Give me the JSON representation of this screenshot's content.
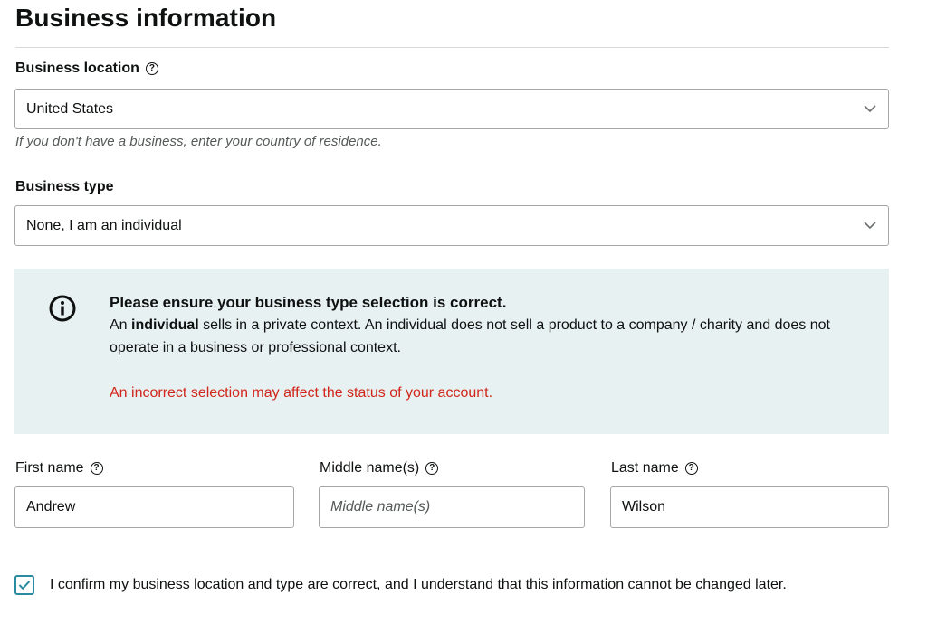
{
  "page": {
    "title": "Business information"
  },
  "business_location": {
    "label": "Business location",
    "value": "United States",
    "hint": "If you don't have a business, enter your country of residence."
  },
  "business_type": {
    "label": "Business type",
    "value": "None, I am an individual"
  },
  "alert": {
    "heading": "Please ensure your business type selection is correct.",
    "body_pre": "An ",
    "body_bold": "individual",
    "body_post": " sells in a private context. An individual does not sell a product to a company / charity and does not operate in a business or professional context.",
    "warning": "An incorrect selection may affect the status of your account."
  },
  "name": {
    "first_label": "First name",
    "first_value": "Andrew",
    "middle_label": "Middle name(s)",
    "middle_value": "",
    "middle_placeholder": "Middle name(s)",
    "last_label": "Last name",
    "last_value": "Wilson"
  },
  "confirm": {
    "checked": true,
    "text": "I confirm my business location and type are correct, and I understand that this information cannot be changed later."
  },
  "colors": {
    "alert_bg": "#e8f1f1",
    "warning": "#d1261b",
    "checkbox": "#2a8a9f"
  }
}
